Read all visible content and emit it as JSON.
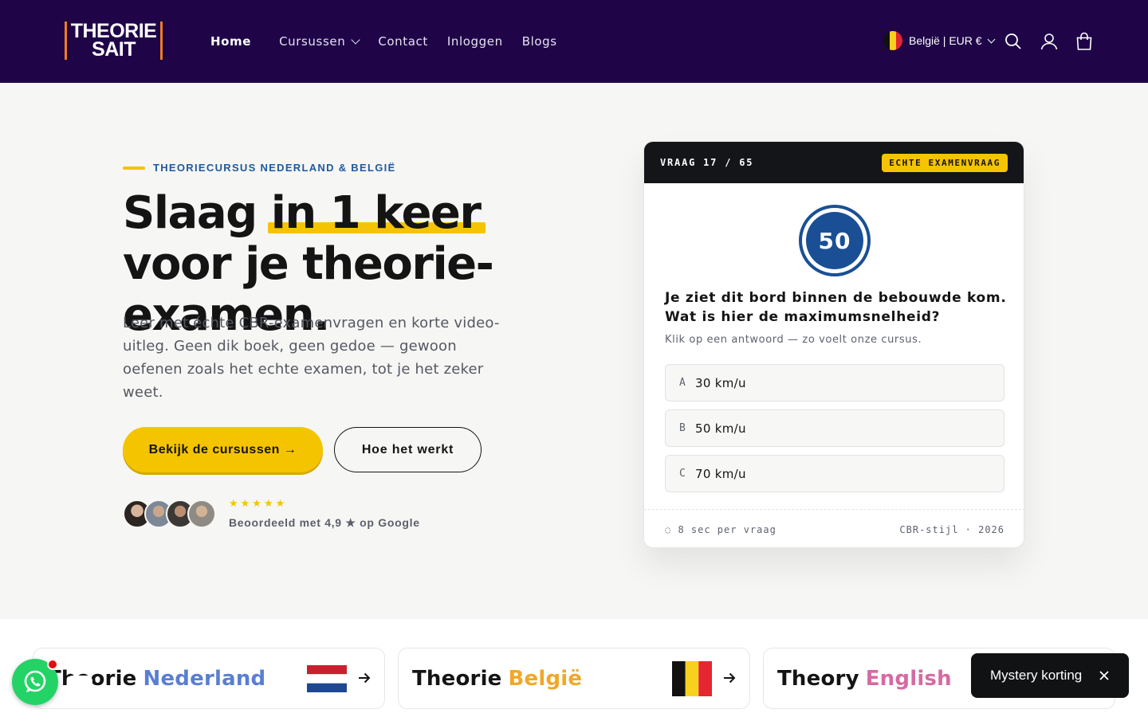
{
  "header": {
    "logo_line1": "THEORIE",
    "logo_line2": "SAIT",
    "nav": [
      {
        "label": "Home"
      },
      {
        "label": "Cursussen"
      },
      {
        "label": "Contact"
      },
      {
        "label": "Inloggen"
      },
      {
        "label": "Blogs"
      }
    ],
    "locale": "België | EUR €",
    "icons": [
      "search-icon",
      "account-icon",
      "cart-icon"
    ]
  },
  "hero": {
    "eyebrow": "THEORIECURSUS NEDERLAND & BELGIË",
    "headline_pre": "Slaag ",
    "headline_highlight": "in 1 keer",
    "headline_post": " voor je theorie-examen.",
    "lead": "Leer met échte CBR-examenvragen en korte video-uitleg. Geen dik boek, geen gedoe — gewoon oefenen zoals het echte examen, tot je het zeker weet.",
    "primary_cta": "Bekijk de cursussen →",
    "secondary_cta": "Hoe het werkt",
    "stars": "★★★★★",
    "rating_text": "Beoordeeld met 4,9 ★ op Google"
  },
  "quiz": {
    "counter": "VRAAG 17 / 65",
    "badge": "ECHTE EXAMENVRAAG",
    "sign_value": "50",
    "question": "Je ziet dit bord binnen de bebouwde kom. Wat is hier de maximumsnelheid?",
    "hint": "Klik op een antwoord — zo voelt onze cursus.",
    "answers": [
      {
        "letter": "A",
        "text": "30 km/u"
      },
      {
        "letter": "B",
        "text": "50 km/u"
      },
      {
        "letter": "C",
        "text": "70 km/u"
      }
    ],
    "footer_left": "◌ 8 sec per vraag",
    "footer_right": "CBR-stijl · 2026"
  },
  "courses": [
    {
      "prefix": "Theorie",
      "country": "Nederland",
      "color": "#5a7fd0"
    },
    {
      "prefix": "Theorie",
      "country": "België",
      "color": "#f0a828"
    },
    {
      "prefix": "Theory",
      "country": "English",
      "color": "#d66aa2"
    }
  ],
  "mystery": {
    "label": "Mystery korting"
  },
  "colors": {
    "header_bg": "#1f0548",
    "accent": "#f5c400",
    "brand_blue": "#1e5aa0",
    "whatsapp": "#24d366"
  }
}
